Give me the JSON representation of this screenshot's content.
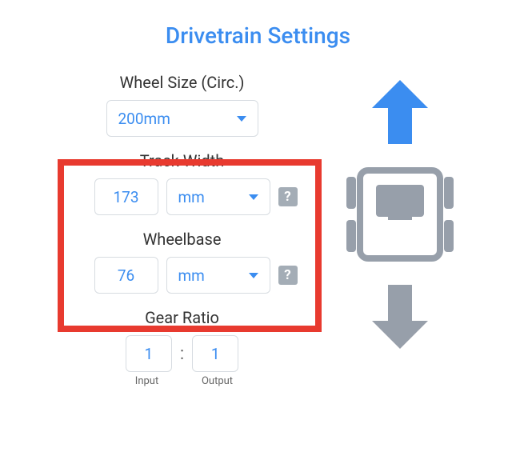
{
  "title": "Drivetrain Settings",
  "wheel_size": {
    "label": "Wheel Size (Circ.)",
    "value": "200mm"
  },
  "track_width": {
    "label": "Track Width",
    "value": "173",
    "unit": "mm"
  },
  "wheelbase": {
    "label": "Wheelbase",
    "value": "76",
    "unit": "mm"
  },
  "gear_ratio": {
    "label": "Gear Ratio",
    "input": "1",
    "output": "1",
    "input_label": "Input",
    "output_label": "Output"
  },
  "help_glyph": "?",
  "colors": {
    "accent": "#3b8df0",
    "highlight": "#e83a2f",
    "muted": "#979faa"
  }
}
